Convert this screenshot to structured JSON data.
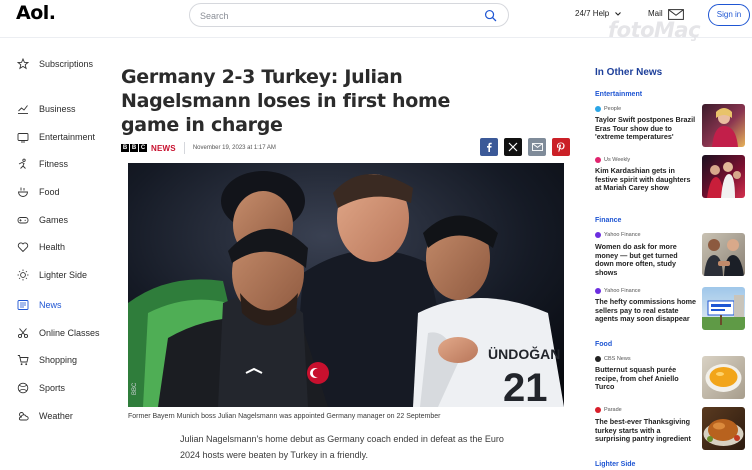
{
  "header": {
    "logo": "Aol.",
    "search_placeholder": "Search",
    "help_label": "24/7 Help",
    "mail_label": "Mail",
    "signin_label": "Sign in",
    "watermark": "fotoMaç"
  },
  "sidebar": {
    "items": [
      {
        "label": "Subscriptions",
        "icon": "star-icon"
      },
      {
        "label": "Business",
        "icon": "chart-icon"
      },
      {
        "label": "Entertainment",
        "icon": "tv-icon"
      },
      {
        "label": "Fitness",
        "icon": "fitness-icon"
      },
      {
        "label": "Food",
        "icon": "food-icon"
      },
      {
        "label": "Games",
        "icon": "gamepad-icon"
      },
      {
        "label": "Health",
        "icon": "heart-icon"
      },
      {
        "label": "Lighter Side",
        "icon": "sun-icon"
      },
      {
        "label": "News",
        "icon": "newspaper-icon",
        "active": true
      },
      {
        "label": "Online Classes",
        "icon": "scissors-icon"
      },
      {
        "label": "Shopping",
        "icon": "cart-icon"
      },
      {
        "label": "Sports",
        "icon": "sports-icon"
      },
      {
        "label": "Weather",
        "icon": "weather-icon"
      }
    ]
  },
  "article": {
    "headline_lines": [
      "Germany 2-3 Turkey: Julian",
      "Nagelsmann loses in first home",
      "game in charge"
    ],
    "source_logo": "BBC",
    "source_word": "NEWS",
    "date": "November 19, 2023 at 1:17 AM",
    "share_icons": [
      "facebook-icon",
      "x-icon",
      "email-icon",
      "pinterest-icon"
    ],
    "jersey_text": "ÜNDOĞAN",
    "photo_credit": "BBC",
    "caption": "Former Bayern Munich boss Julian Nagelsmann was appointed Germany manager on 22 September",
    "body_lines": [
      "Julian Nagelsmann's home debut as Germany coach ended in defeat as the Euro",
      "2024 hosts were beaten by Turkey in a friendly."
    ]
  },
  "right_rail": {
    "title": "In Other News",
    "sections": [
      {
        "category": "Entertainment",
        "stories": [
          {
            "source": "People",
            "source_color": "#2aa5e6",
            "headline": "Taylor Swift postpones Brazil Eras Tour show due to 'extreme temperatures'"
          },
          {
            "source": "Us Weekly",
            "source_color": "#e0246e",
            "headline": "Kim Kardashian gets in festive spirit with daughters at Mariah Carey show"
          }
        ]
      },
      {
        "category": "Finance",
        "stories": [
          {
            "source": "Yahoo Finance",
            "source_color": "#6c2ee0",
            "headline": "Women do ask for more money — but get turned down more often, study shows"
          },
          {
            "source": "Yahoo Finance",
            "source_color": "#6c2ee0",
            "headline": "The hefty commissions home sellers pay to real estate agents may soon disappear"
          }
        ]
      },
      {
        "category": "Food",
        "stories": [
          {
            "source": "CBS News",
            "source_color": "#222222",
            "headline": "Butternut squash purée recipe, from chef Aniello Turco"
          },
          {
            "source": "Parade",
            "source_color": "#d81e2a",
            "headline": "The best-ever Thanksgiving turkey starts with a surprising pantry ingredient"
          }
        ]
      },
      {
        "category": "Lighter Side",
        "stories": []
      }
    ]
  },
  "colors": {
    "accent_blue": "#1f56d3",
    "bbc_red": "#c8102e",
    "facebook": "#3b5998",
    "x": "#111111",
    "email": "#7f8b99",
    "pinterest": "#cb2027"
  }
}
